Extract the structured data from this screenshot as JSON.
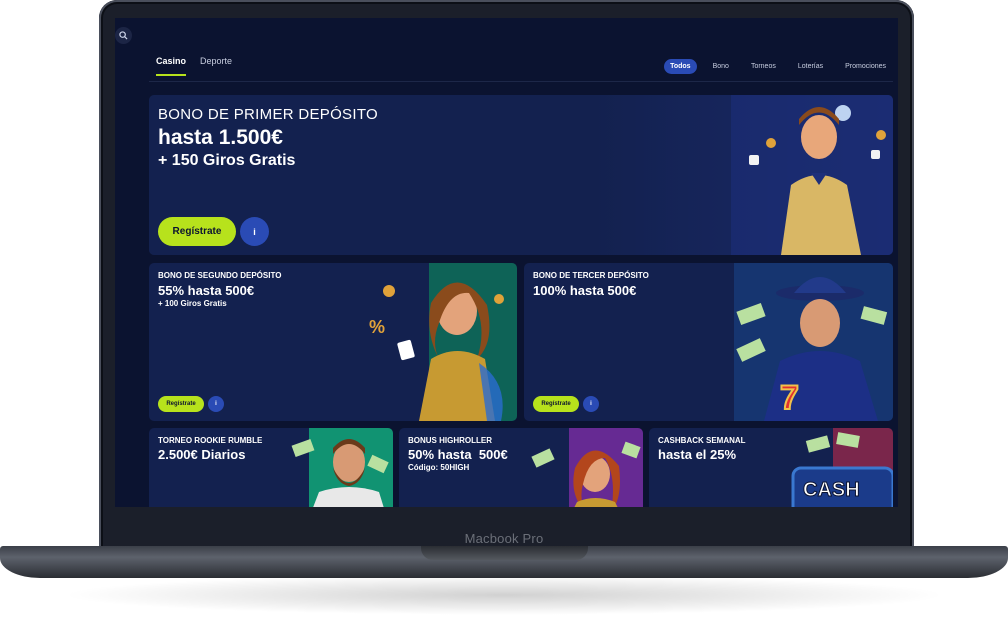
{
  "device": {
    "label": "Macbook Pro"
  },
  "nav": {
    "tabs": [
      {
        "label": "Casino",
        "active": true
      },
      {
        "label": "Deporte",
        "active": false
      }
    ],
    "filters": [
      {
        "label": "Todos",
        "active": true
      },
      {
        "label": "Bono",
        "active": false
      },
      {
        "label": "Torneos",
        "active": false
      },
      {
        "label": "Loterías",
        "active": false
      },
      {
        "label": "Promociones",
        "active": false
      }
    ]
  },
  "hero": {
    "kicker": "BONO DE PRIMER DEPÓSITO",
    "title": "hasta 1.500€",
    "subtitle": "+ 150 Giros Gratis",
    "cta": "Regístrate",
    "info_icon": "i"
  },
  "promo2": {
    "kicker": "BONO DE SEGUNDO DEPÓSITO",
    "title": "55% hasta 500€",
    "subtitle": "+ 100 Giros Gratis",
    "cta": "Regístrate",
    "info_icon": "i"
  },
  "promo3": {
    "kicker": "BONO DE TERCER DEPÓSITO",
    "title": "100% hasta 500€",
    "cta": "Regístrate",
    "info_icon": "i"
  },
  "promo4": {
    "kicker": "TORNEO ROOKIE RUMBLE",
    "title": "2.500€ Diarios"
  },
  "promo5": {
    "kicker": "BONUS HIGHROLLER",
    "title": "50% hasta  500€",
    "subtitle": "Código: 50HIGH"
  },
  "promo6": {
    "kicker": "CASHBACK SEMANAL",
    "title": "hasta el 25%",
    "art_text": "CASH"
  },
  "colors": {
    "accent": "#b7e21c",
    "bg": "#0b1330",
    "card": "#13214f",
    "chip": "#2a4bb5"
  }
}
